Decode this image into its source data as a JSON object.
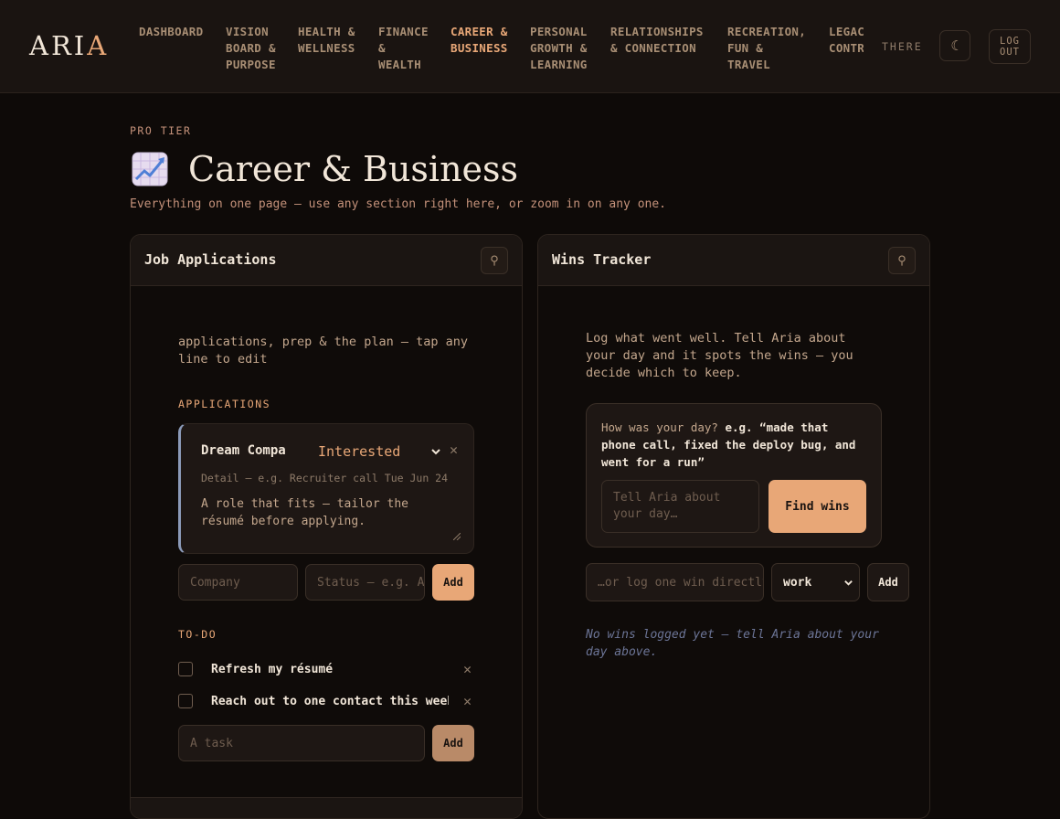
{
  "header": {
    "logo_main": "ARI",
    "logo_accent": "A",
    "nav": [
      {
        "label": "DASHBOARD",
        "active": false
      },
      {
        "label": "VISION\nBOARD &\nPURPOSE",
        "active": false
      },
      {
        "label": "HEALTH &\nWELLNESS",
        "active": false
      },
      {
        "label": "FINANCE\n&\nWEALTH",
        "active": false
      },
      {
        "label": "CAREER &\nBUSINESS",
        "active": true
      },
      {
        "label": "PERSONAL\nGROWTH &\nLEARNING",
        "active": false
      },
      {
        "label": "RELATIONSHIPS\n& CONNECTION",
        "active": false
      },
      {
        "label": "RECREATION,\nFUN &\nTRAVEL",
        "active": false
      },
      {
        "label": "LEGACY &\nCONTRIBUTION",
        "active": false
      }
    ],
    "greeting": "THERE",
    "theme_icon": "☾",
    "logout_label": "LOG\nOUT"
  },
  "page": {
    "tier": "PRO TIER",
    "title_icon": "chart-increasing-icon",
    "title": "Career & Business",
    "subtitle": "Everything on one page — use any section right here, or zoom in on any one."
  },
  "job_card": {
    "title": "Job Applications",
    "pin_icon": "⚲",
    "intro": "applications, prep & the plan — tap any line to edit",
    "applications_label": "APPLICATIONS",
    "application": {
      "company": "Dream Compa",
      "status": "Interested",
      "detail_placeholder": "Detail — e.g. Recruiter call Tue Jun 24",
      "note": "A role that fits — tailor the résumé before applying.",
      "accent": "#8b9ab8"
    },
    "company_placeholder": "Company",
    "status_placeholder": "Status — e.g. Applied",
    "add_label": "Add",
    "todo_label": "TO-DO",
    "todos": [
      {
        "text": "Refresh my résumé",
        "done": false
      },
      {
        "text": "Reach out to one contact this week",
        "done": false
      }
    ],
    "task_placeholder": "A task",
    "task_add_label": "Add"
  },
  "wins_card": {
    "title": "Wins Tracker",
    "pin_icon": "⚲",
    "intro": "Log what went well. Tell Aria about your day and it spots the wins — you decide which to keep.",
    "prompt_question": "How was your day? ",
    "prompt_example": "e.g. “made that phone call, fixed the deploy bug, and went for a run”",
    "day_placeholder": "Tell Aria about your day…",
    "find_wins_label": "Find wins",
    "direct_placeholder": "…or log one win directly",
    "category_value": "work",
    "add_label": "Add",
    "empty_text": "No wins logged yet — tell Aria about your day above."
  },
  "colors": {
    "accent": "#e8a777",
    "background": "#0e0a08",
    "panel": "#1b1512",
    "application_accent": "#8b9ab8"
  }
}
